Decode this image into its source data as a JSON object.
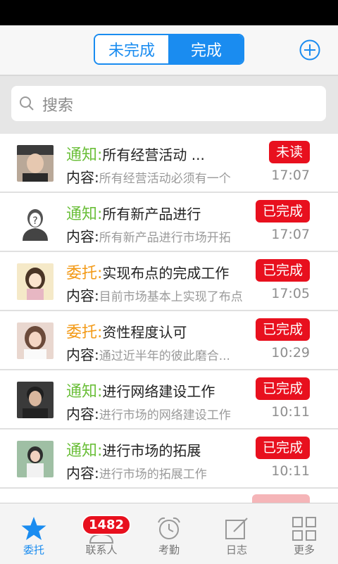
{
  "header": {
    "seg_left": "未完成",
    "seg_right": "完成"
  },
  "search": {
    "placeholder": "搜索"
  },
  "list": [
    {
      "kind": "通知:",
      "kind_type": "notice",
      "title": "所有经营活动 ...",
      "content_label": "内容:",
      "content": "所有经营活动必须有一个",
      "badge": "未读",
      "time": "17:07",
      "avatar": "photo-male"
    },
    {
      "kind": "通知:",
      "kind_type": "notice",
      "title": "所有新产品进行",
      "content_label": "内容:",
      "content": "所有新产品进行市场开拓",
      "badge": "已完成",
      "time": "17:07",
      "avatar": "default-person"
    },
    {
      "kind": "委托:",
      "kind_type": "task",
      "title": "实现布点的完成工作",
      "content_label": "内容:",
      "content": "目前市场基本上实现了布点",
      "badge": "已完成",
      "time": "17:05",
      "avatar": "cartoon-girl"
    },
    {
      "kind": "委托:",
      "kind_type": "task",
      "title": "资性程度认可",
      "content_label": "内容:",
      "content": "通过近半年的彼此磨合...",
      "badge": "已完成",
      "time": "10:29",
      "avatar": "photo-female"
    },
    {
      "kind": "通知:",
      "kind_type": "notice",
      "title": "进行网络建设工作",
      "content_label": "内容:",
      "content": "进行市场的网络建设工作",
      "badge": "已完成",
      "time": "10:11",
      "avatar": "photo-male-2"
    },
    {
      "kind": "通知:",
      "kind_type": "notice",
      "title": "进行市场的拓展",
      "content_label": "内容:",
      "content": "进行市场的拓展工作",
      "badge": "已完成",
      "time": "10:11",
      "avatar": "photo-female-2"
    }
  ],
  "tabs": [
    {
      "label": "委托",
      "icon": "star-icon"
    },
    {
      "label": "联系人",
      "icon": "contacts-icon",
      "badge": "1482"
    },
    {
      "label": "考勤",
      "icon": "alarm-clock-icon"
    },
    {
      "label": "日志",
      "icon": "edit-icon"
    },
    {
      "label": "更多",
      "icon": "grid-icon"
    }
  ],
  "colors": {
    "accent": "#1a8cf0",
    "badge": "#e8101e",
    "notice": "#6bbf3a",
    "task": "#f39a17"
  }
}
